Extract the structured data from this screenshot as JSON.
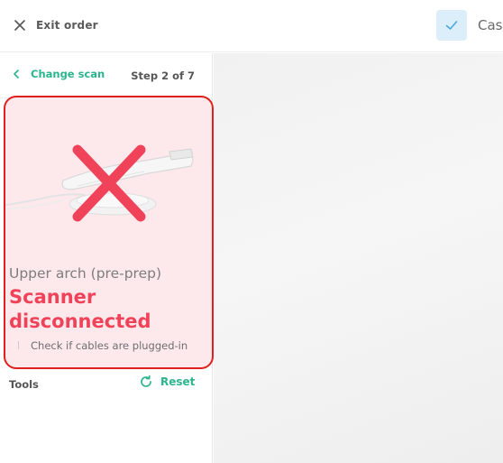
{
  "topbar": {
    "exit_label": "Exit order",
    "exit_icon": "close-icon",
    "check_icon": "check-icon",
    "case_label": "Cas"
  },
  "sidebar": {
    "change_scan_label": "Change scan",
    "step_label": "Step 2 of 7",
    "card": {
      "arch_label": "Upper arch (pre-prep)",
      "status_label": "Scanner disconnected",
      "hint_label": "Check if cables are plugged-in",
      "status_icon": "error-x-icon",
      "device_image": "intraoral-scanner"
    },
    "tools_label": "Tools",
    "reset_label": "Reset"
  },
  "colors": {
    "accent": "#2bb58e",
    "error": "#f0435a",
    "error_border": "#e0201e",
    "card_bg": "#fde9ec",
    "check_bg": "#dbeef9"
  }
}
